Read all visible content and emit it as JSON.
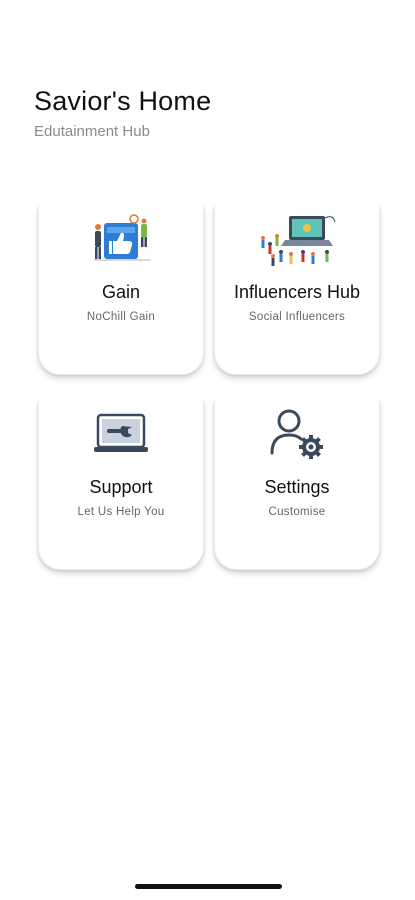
{
  "header": {
    "title": "Savior's Home",
    "subtitle": "Edutainment Hub"
  },
  "cards": [
    {
      "label": "Gain",
      "sublabel": "NoChill Gain",
      "icon": "social-like-illustration-icon"
    },
    {
      "label": "Influencers Hub",
      "sublabel": "Social Influencers",
      "icon": "influencers-laptop-illustration-icon"
    },
    {
      "label": "Support",
      "sublabel": "Let Us Help You",
      "icon": "laptop-wrench-icon"
    },
    {
      "label": "Settings",
      "sublabel": "Customise",
      "icon": "user-gear-icon"
    }
  ],
  "colors": {
    "background": "#ffffff",
    "title": "#111111",
    "subtitle": "#8a8a8a",
    "icon_stroke": "#3a4a5c",
    "illustration_blue": "#2d7dd2"
  }
}
